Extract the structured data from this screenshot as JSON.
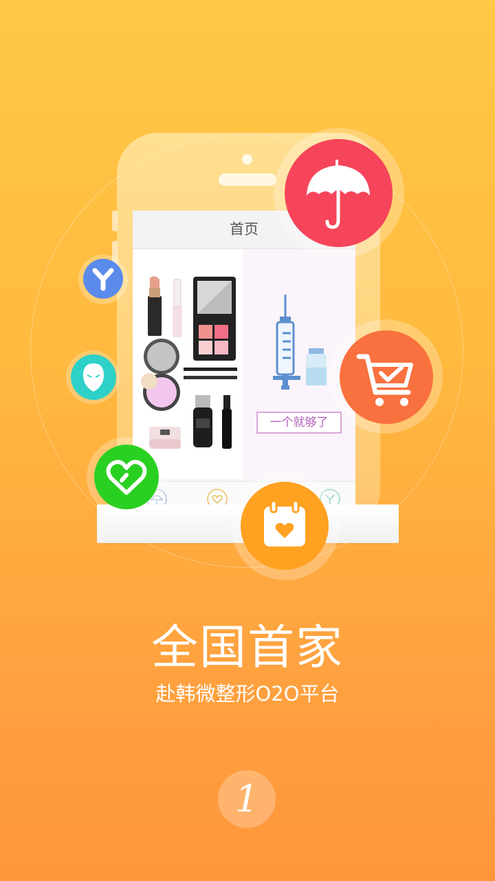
{
  "screen": {
    "header_title": "首页",
    "banner_slogan": "一个就够了"
  },
  "headline": "全国首家",
  "subheadline": "赴韩微整形O2O平台",
  "page_number": "1",
  "feature_icons": [
    {
      "name": "umbrella-icon",
      "color": "#f6455a"
    },
    {
      "name": "cart-check-icon",
      "color": "#f9713e"
    },
    {
      "name": "calendar-heart-icon",
      "color": "#ffa121"
    },
    {
      "name": "heart-icon",
      "color": "#29d021"
    },
    {
      "name": "face-icon",
      "color": "#2ed1c8"
    },
    {
      "name": "y-logo-icon",
      "color": "#5b8bea"
    }
  ],
  "tabbar_icons": [
    "umbrella-icon",
    "heart-icon",
    "calendar-heart-icon",
    "y-logo-icon"
  ],
  "colors": {
    "background_top": "#ffc847",
    "background_bottom": "#ff963c",
    "text": "#ffffff"
  }
}
